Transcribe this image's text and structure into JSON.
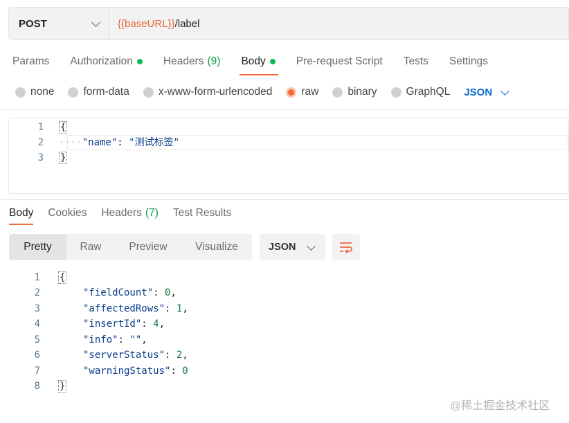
{
  "request": {
    "method": "POST",
    "url_variable": "{{baseURL}}",
    "url_path": "/label"
  },
  "request_tabs": [
    {
      "label": "Params",
      "badge": ""
    },
    {
      "label": "Authorization",
      "badge": "dot"
    },
    {
      "label": "Headers",
      "count": "(9)"
    },
    {
      "label": "Body",
      "badge": "dot",
      "active": true
    },
    {
      "label": "Pre-request Script"
    },
    {
      "label": "Tests"
    },
    {
      "label": "Settings"
    }
  ],
  "body_types": [
    "none",
    "form-data",
    "x-www-form-urlencoded",
    "raw",
    "binary",
    "GraphQL"
  ],
  "body_type_selected": "raw",
  "body_format": "JSON",
  "request_body": {
    "line_numbers": [
      "1",
      "2",
      "3"
    ],
    "open": "{",
    "key": "\"name\"",
    "colon": ": ",
    "value": "\"测试标签\"",
    "close": "}"
  },
  "response_tabs": [
    {
      "label": "Body",
      "active": true
    },
    {
      "label": "Cookies"
    },
    {
      "label": "Headers",
      "count": "(7)"
    },
    {
      "label": "Test Results"
    }
  ],
  "view_modes": [
    "Pretty",
    "Raw",
    "Preview",
    "Visualize"
  ],
  "response_format": "JSON",
  "response_body": {
    "line_numbers": [
      "1",
      "2",
      "3",
      "4",
      "5",
      "6",
      "7",
      "8"
    ],
    "open": "{",
    "fields": [
      {
        "key": "\"fieldCount\"",
        "value": "0",
        "sep": ","
      },
      {
        "key": "\"affectedRows\"",
        "value": "1",
        "sep": ","
      },
      {
        "key": "\"insertId\"",
        "value": "4",
        "sep": ","
      },
      {
        "key": "\"info\"",
        "value": "\"\"",
        "sep": ","
      },
      {
        "key": "\"serverStatus\"",
        "value": "2",
        "sep": ","
      },
      {
        "key": "\"warningStatus\"",
        "value": "0",
        "sep": ""
      }
    ],
    "close": "}"
  },
  "watermark": "@稀土掘金技术社区",
  "colors": {
    "accent": "#ef6c3f",
    "green": "#0cbb52",
    "blue": "#0f6bc7"
  }
}
